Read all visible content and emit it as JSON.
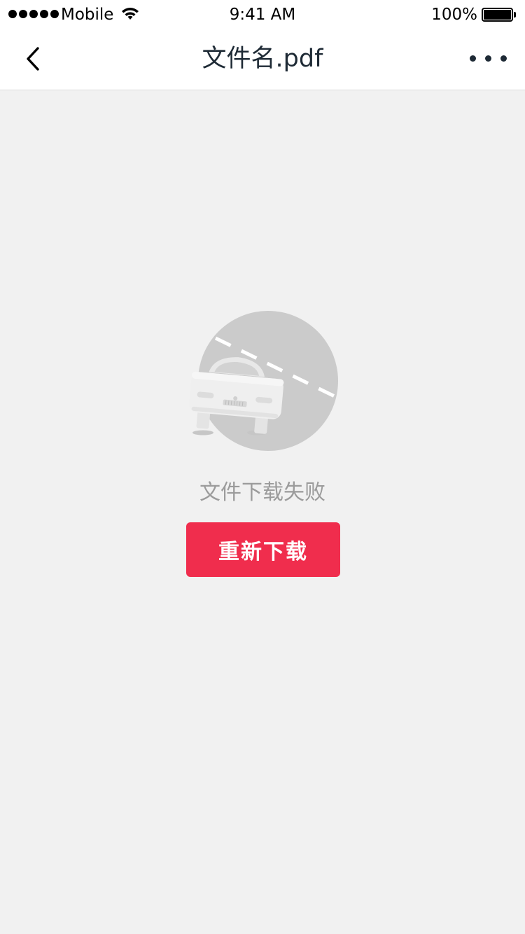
{
  "status_bar": {
    "carrier": "Mobile",
    "time": "9:41 AM",
    "battery_percent": "100%"
  },
  "nav": {
    "title": "文件名.pdf",
    "back_icon": "chevron-left-icon",
    "more_icon": "more-horizontal-icon"
  },
  "empty_state": {
    "illustration": "broken-down-car-illustration",
    "message": "文件下载失败",
    "retry_label": "重新下载"
  },
  "colors": {
    "background": "#f1f1f1",
    "accent": "#f02d4d",
    "title": "#1e2a35",
    "message": "#9b9b9b"
  }
}
